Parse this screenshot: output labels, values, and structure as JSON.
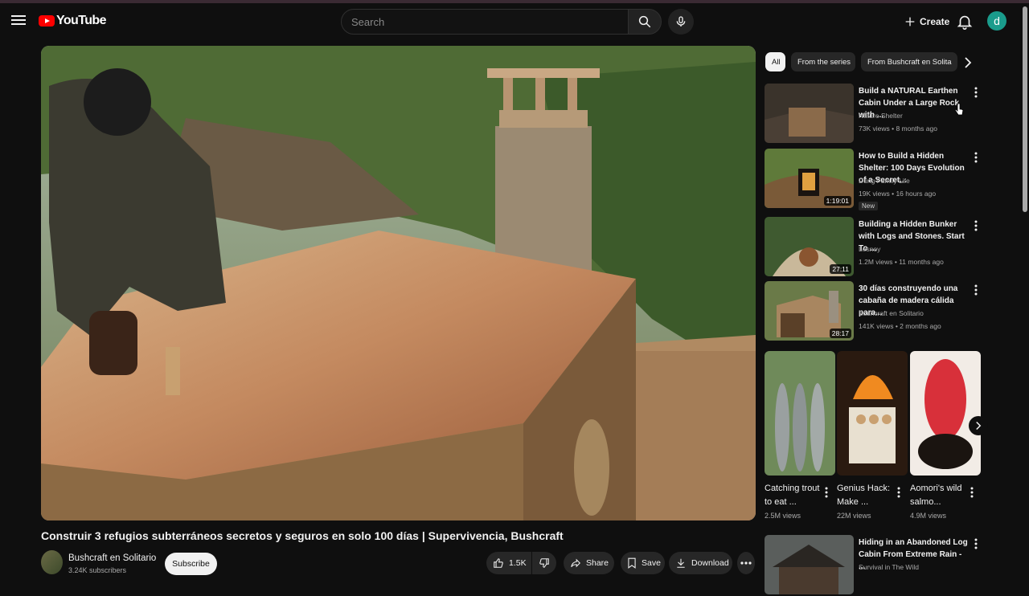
{
  "header": {
    "logo_text": "YouTube",
    "search_placeholder": "Search",
    "create_label": "Create",
    "avatar_letter": "d"
  },
  "video": {
    "title": "Construir 3 refugios subterráneos secretos y seguros en solo 100 días | Supervivencia, Bushcraft",
    "channel": "Bushcraft en Solitario",
    "subscribers": "3.24K subscribers",
    "subscribe_label": "Subscribe",
    "likes": "1.5K",
    "share_label": "Share",
    "save_label": "Save",
    "download_label": "Download"
  },
  "chips": [
    {
      "label": "All",
      "active": true
    },
    {
      "label": "From the series",
      "active": false
    },
    {
      "label": "From Bushcraft en Solita",
      "active": false
    }
  ],
  "recommendations": [
    {
      "title": "Build a NATURAL Earthen Cabin Under a Large Rock with ...",
      "channel": "Nature Shelter",
      "meta": "73K views • 8 months ago",
      "duration": "",
      "badge": ""
    },
    {
      "title": "How to Build a Hidden Shelter: 100 Days Evolution of a Secret...",
      "channel": "Dũng Family Life",
      "meta": "19K views • 16 hours ago",
      "duration": "1:19:01",
      "badge": "New"
    },
    {
      "title": "Building a Hidden Bunker with Logs and Stones. Start To ...",
      "channel": "Lesnoy",
      "meta": "1.2M views • 11 months ago",
      "duration": "27:11",
      "badge": ""
    },
    {
      "title": "30 días construyendo una cabaña de madera cálida para...",
      "channel": "Bushcraft en Solitario",
      "meta": "141K views • 2 months ago",
      "duration": "28:17",
      "badge": ""
    },
    {
      "title": "Hiding in an Abandoned Log Cabin From Extreme Rain - ...",
      "channel": "Survival in The Wild",
      "meta": "",
      "duration": "",
      "badge": ""
    }
  ],
  "shorts": [
    {
      "title": "Catching trout to eat ...",
      "views": "2.5M views"
    },
    {
      "title": "Genius Hack: Make ...",
      "views": "22M views"
    },
    {
      "title": "Aomori's wild salmo...",
      "views": "4.9M views"
    }
  ]
}
